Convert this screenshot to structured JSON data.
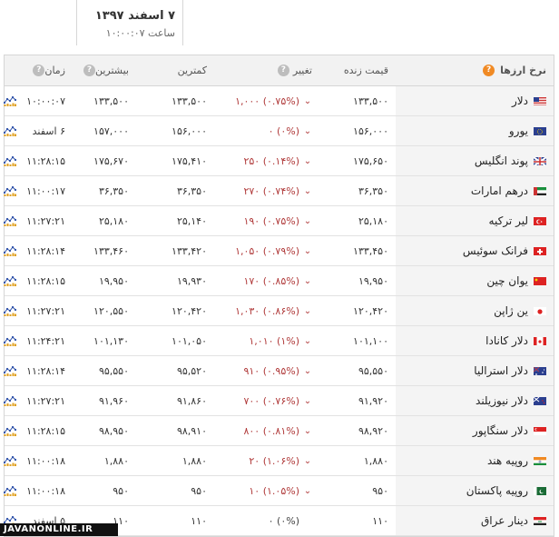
{
  "date": {
    "main": "۷ اسفند ۱۳۹۷",
    "time": "ساعت ۱۰:۰۰:۰۷"
  },
  "header": {
    "name": "نرخ ارزها",
    "price": "قیمت زنده",
    "change": "تغییر",
    "low": "کمترین",
    "high": "بیشترین",
    "time": "زمان"
  },
  "rows": [
    {
      "name": "دلار",
      "price": "۱۳۳,۵۰۰",
      "change": "(۰.۷۵%) ۱,۰۰۰",
      "dir": "down",
      "low": "۱۳۳,۵۰۰",
      "high": "۱۳۳,۵۰۰",
      "time": "۱۰:۰۰:۰۷",
      "flag": "us"
    },
    {
      "name": "یورو",
      "price": "۱۵۶,۰۰۰",
      "change": "(۰%) ۰",
      "dir": "down",
      "low": "۱۵۶,۰۰۰",
      "high": "۱۵۷,۰۰۰",
      "time": "۶ اسفند",
      "flag": "eu"
    },
    {
      "name": "پوند انگلیس",
      "price": "۱۷۵,۶۵۰",
      "change": "(۰.۱۴%) ۲۵۰",
      "dir": "down",
      "low": "۱۷۵,۴۱۰",
      "high": "۱۷۵,۶۷۰",
      "time": "۱۱:۲۸:۱۵",
      "flag": "gb"
    },
    {
      "name": "درهم امارات",
      "price": "۳۶,۳۵۰",
      "change": "(۰.۷۴%) ۲۷۰",
      "dir": "down",
      "low": "۳۶,۳۵۰",
      "high": "۳۶,۳۵۰",
      "time": "۱۱:۰۰:۱۷",
      "flag": "ae"
    },
    {
      "name": "لیر ترکیه",
      "price": "۲۵,۱۸۰",
      "change": "(۰.۷۵%) ۱۹۰",
      "dir": "down",
      "low": "۲۵,۱۴۰",
      "high": "۲۵,۱۸۰",
      "time": "۱۱:۲۷:۲۱",
      "flag": "tr"
    },
    {
      "name": "فرانک سوئیس",
      "price": "۱۳۳,۴۵۰",
      "change": "(۰.۷۹%) ۱,۰۵۰",
      "dir": "down",
      "low": "۱۳۳,۴۲۰",
      "high": "۱۳۳,۴۶۰",
      "time": "۱۱:۲۸:۱۴",
      "flag": "ch"
    },
    {
      "name": "یوان چین",
      "price": "۱۹,۹۵۰",
      "change": "(۰.۸۵%) ۱۷۰",
      "dir": "down",
      "low": "۱۹,۹۳۰",
      "high": "۱۹,۹۵۰",
      "time": "۱۱:۲۸:۱۵",
      "flag": "cn"
    },
    {
      "name": "ین ژاپن",
      "price": "۱۲۰,۴۲۰",
      "change": "(۰.۸۶%) ۱,۰۳۰",
      "dir": "down",
      "low": "۱۲۰,۴۲۰",
      "high": "۱۲۰,۵۵۰",
      "time": "۱۱:۲۷:۲۱",
      "flag": "jp"
    },
    {
      "name": "دلار کانادا",
      "price": "۱۰۱,۱۰۰",
      "change": "(۱%) ۱,۰۱۰",
      "dir": "down",
      "low": "۱۰۱,۰۵۰",
      "high": "۱۰۱,۱۳۰",
      "time": "۱۱:۲۴:۲۱",
      "flag": "ca"
    },
    {
      "name": "دلار استرالیا",
      "price": "۹۵,۵۵۰",
      "change": "(۰.۹۵%) ۹۱۰",
      "dir": "down",
      "low": "۹۵,۵۲۰",
      "high": "۹۵,۵۵۰",
      "time": "۱۱:۲۸:۱۴",
      "flag": "au"
    },
    {
      "name": "دلار نیوزیلند",
      "price": "۹۱,۹۲۰",
      "change": "(۰.۷۶%) ۷۰۰",
      "dir": "down",
      "low": "۹۱,۸۶۰",
      "high": "۹۱,۹۶۰",
      "time": "۱۱:۲۷:۲۱",
      "flag": "nz"
    },
    {
      "name": "دلار سنگاپور",
      "price": "۹۸,۹۲۰",
      "change": "(۰.۸۱%) ۸۰۰",
      "dir": "down",
      "low": "۹۸,۹۱۰",
      "high": "۹۸,۹۵۰",
      "time": "۱۱:۲۸:۱۵",
      "flag": "sg"
    },
    {
      "name": "روپیه هند",
      "price": "۱,۸۸۰",
      "change": "(۱.۰۶%) ۲۰",
      "dir": "down",
      "low": "۱,۸۸۰",
      "high": "۱,۸۸۰",
      "time": "۱۱:۰۰:۱۸",
      "flag": "in"
    },
    {
      "name": "روپیه پاکستان",
      "price": "۹۵۰",
      "change": "(۱.۰۵%) ۱۰",
      "dir": "down",
      "low": "۹۵۰",
      "high": "۹۵۰",
      "time": "۱۱:۰۰:۱۸",
      "flag": "pk"
    },
    {
      "name": "دینار عراق",
      "price": "۱۱۰",
      "change": "(۰%) ۰",
      "dir": "flat",
      "low": "۱۱۰",
      "high": "۱۱۰",
      "time": "۵ اسفند",
      "flag": "iq"
    }
  ],
  "watermark": "JAVANONLINE.IR",
  "colors": {
    "down": "#b03a3a",
    "help_accent": "#f08a24",
    "header_bg": "#f2f2f2",
    "chart_icon": "#e0a020"
  }
}
